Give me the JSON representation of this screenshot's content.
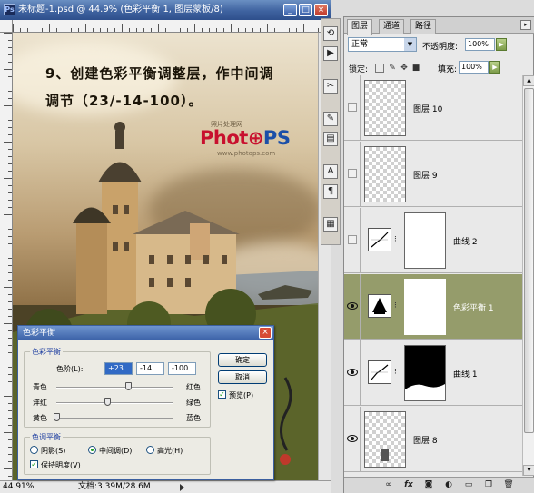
{
  "document": {
    "title": "未标题-1.psd @ 44.9% (色彩平衡 1, 图层蒙板/8)",
    "zoom": "44.91%",
    "status_info": "文档:3.39M/28.6M",
    "step_line1": "9、创建色彩平衡调整层，作中间调",
    "step_line2": "调节（23/-14-100）。",
    "watermark_small": "照片处理网",
    "watermark_left": "Phot",
    "watermark_right": "PS",
    "watermark_url": "www.photops.com"
  },
  "dialog": {
    "title": "色彩平衡",
    "group_balance": "色彩平衡",
    "levels_label": "色阶(L):",
    "levels": [
      "+23",
      "-14",
      "-100"
    ],
    "sliders": [
      {
        "left": "青色",
        "right": "红色",
        "value": 23
      },
      {
        "left": "洋红",
        "right": "绿色",
        "value": -14
      },
      {
        "left": "黄色",
        "right": "蓝色",
        "value": -100
      }
    ],
    "group_tone": "色调平衡",
    "tone_options": [
      "阴影(S)",
      "中间调(D)",
      "高光(H)"
    ],
    "tone_selected": 1,
    "preserve_luminosity": "保持明度(V)",
    "ok": "确定",
    "cancel": "取消",
    "preview": "预览(P)"
  },
  "layers_panel": {
    "tabs": [
      "图层",
      "通道",
      "路径"
    ],
    "blend_mode": "正常",
    "opacity_label": "不透明度:",
    "opacity": "100%",
    "lock_label": "锁定:",
    "fill_label": "填充:",
    "fill": "100%",
    "layers": [
      {
        "name": "图层 10",
        "type": "pixel",
        "visible": false,
        "selected": false
      },
      {
        "name": "图层 9",
        "type": "pixel",
        "visible": false,
        "selected": false
      },
      {
        "name": "曲线 2",
        "type": "curves",
        "visible": false,
        "selected": false
      },
      {
        "name": "色彩平衡 1",
        "type": "color-balance",
        "visible": true,
        "selected": true
      },
      {
        "name": "曲线 1",
        "type": "curves",
        "visible": true,
        "selected": false
      },
      {
        "name": "图层 8",
        "type": "pixel",
        "visible": true,
        "selected": false
      }
    ]
  },
  "colors": {
    "selected_layer": "#959c6b",
    "title_bar": "#3f63a0",
    "watermark_red": "#c8102e",
    "watermark_blue": "#1b4fa8"
  }
}
